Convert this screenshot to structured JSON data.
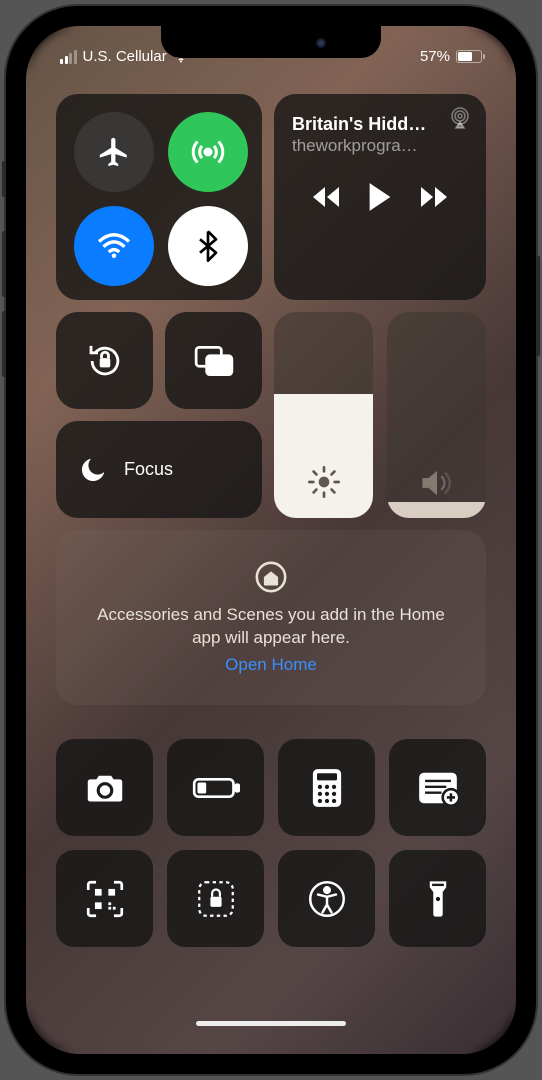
{
  "status": {
    "carrier": "U.S. Cellular",
    "signal_bars_active": 2,
    "wifi": true,
    "battery_pct": "57%",
    "battery_level": 57
  },
  "connectivity": {
    "airplane": "airplane-mode",
    "cellular": "cellular-data",
    "wifi": "wifi",
    "bluetooth": "bluetooth"
  },
  "media": {
    "title": "Britain's Hidd…",
    "subtitle": "theworkprogra…",
    "airplay": "airplay-icon"
  },
  "controls": {
    "rotation_lock": "rotation-lock",
    "screen_mirror": "screen-mirroring",
    "focus_label": "Focus"
  },
  "sliders": {
    "brightness_pct": 60,
    "volume_pct": 7
  },
  "home": {
    "text": "Accessories and Scenes you add in the Home app will appear here.",
    "link": "Open Home"
  },
  "bottom": {
    "camera": "camera",
    "low_power": "low-power-mode",
    "calculator": "calculator",
    "notes": "quick-note",
    "qr": "code-scanner",
    "guided_access": "guided-access",
    "accessibility": "accessibility-shortcut",
    "flashlight": "flashlight"
  },
  "highlight": "volume-slider"
}
